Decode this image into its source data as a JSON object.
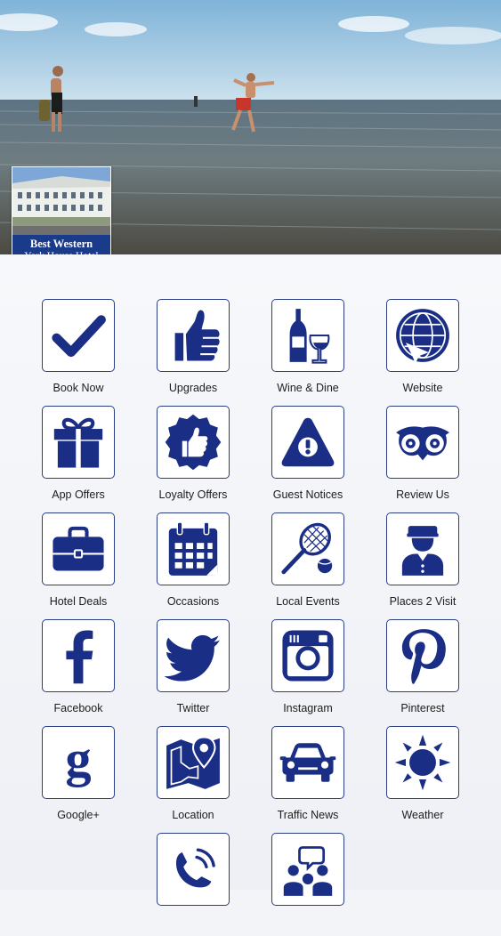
{
  "hotel": {
    "name_line1": "Best Western",
    "name_line2": "York House Hotel"
  },
  "colors": {
    "icon": "#1b2e86",
    "border": "#2a3f83",
    "label": "#1d1d1d",
    "background": "#f3f4f8"
  },
  "tiles": [
    {
      "label": "Book Now",
      "icon": "checkmark-icon"
    },
    {
      "label": "Upgrades",
      "icon": "thumbs-up-icon"
    },
    {
      "label": "Wine & Dine",
      "icon": "wine-icon"
    },
    {
      "label": "Website",
      "icon": "globe-icon"
    },
    {
      "label": "App Offers",
      "icon": "gift-icon"
    },
    {
      "label": "Loyalty Offers",
      "icon": "loyalty-badge-icon"
    },
    {
      "label": "Guest Notices",
      "icon": "warning-icon"
    },
    {
      "label": "Review Us",
      "icon": "tripadvisor-owl-icon"
    },
    {
      "label": "Hotel Deals",
      "icon": "briefcase-icon"
    },
    {
      "label": "Occasions",
      "icon": "calendar-icon"
    },
    {
      "label": "Local Events",
      "icon": "tennis-icon"
    },
    {
      "label": "Places 2 Visit",
      "icon": "bellboy-icon"
    },
    {
      "label": "Facebook",
      "icon": "facebook-icon"
    },
    {
      "label": "Twitter",
      "icon": "twitter-icon"
    },
    {
      "label": "Instagram",
      "icon": "instagram-icon"
    },
    {
      "label": "Pinterest",
      "icon": "pinterest-icon"
    },
    {
      "label": "Google+",
      "icon": "google-plus-icon"
    },
    {
      "label": "Location",
      "icon": "map-pin-icon"
    },
    {
      "label": "Traffic News",
      "icon": "car-icon"
    },
    {
      "label": "Weather",
      "icon": "sun-icon"
    },
    {
      "label": "",
      "icon": "phone-icon"
    },
    {
      "label": "",
      "icon": "chat-people-icon"
    }
  ]
}
